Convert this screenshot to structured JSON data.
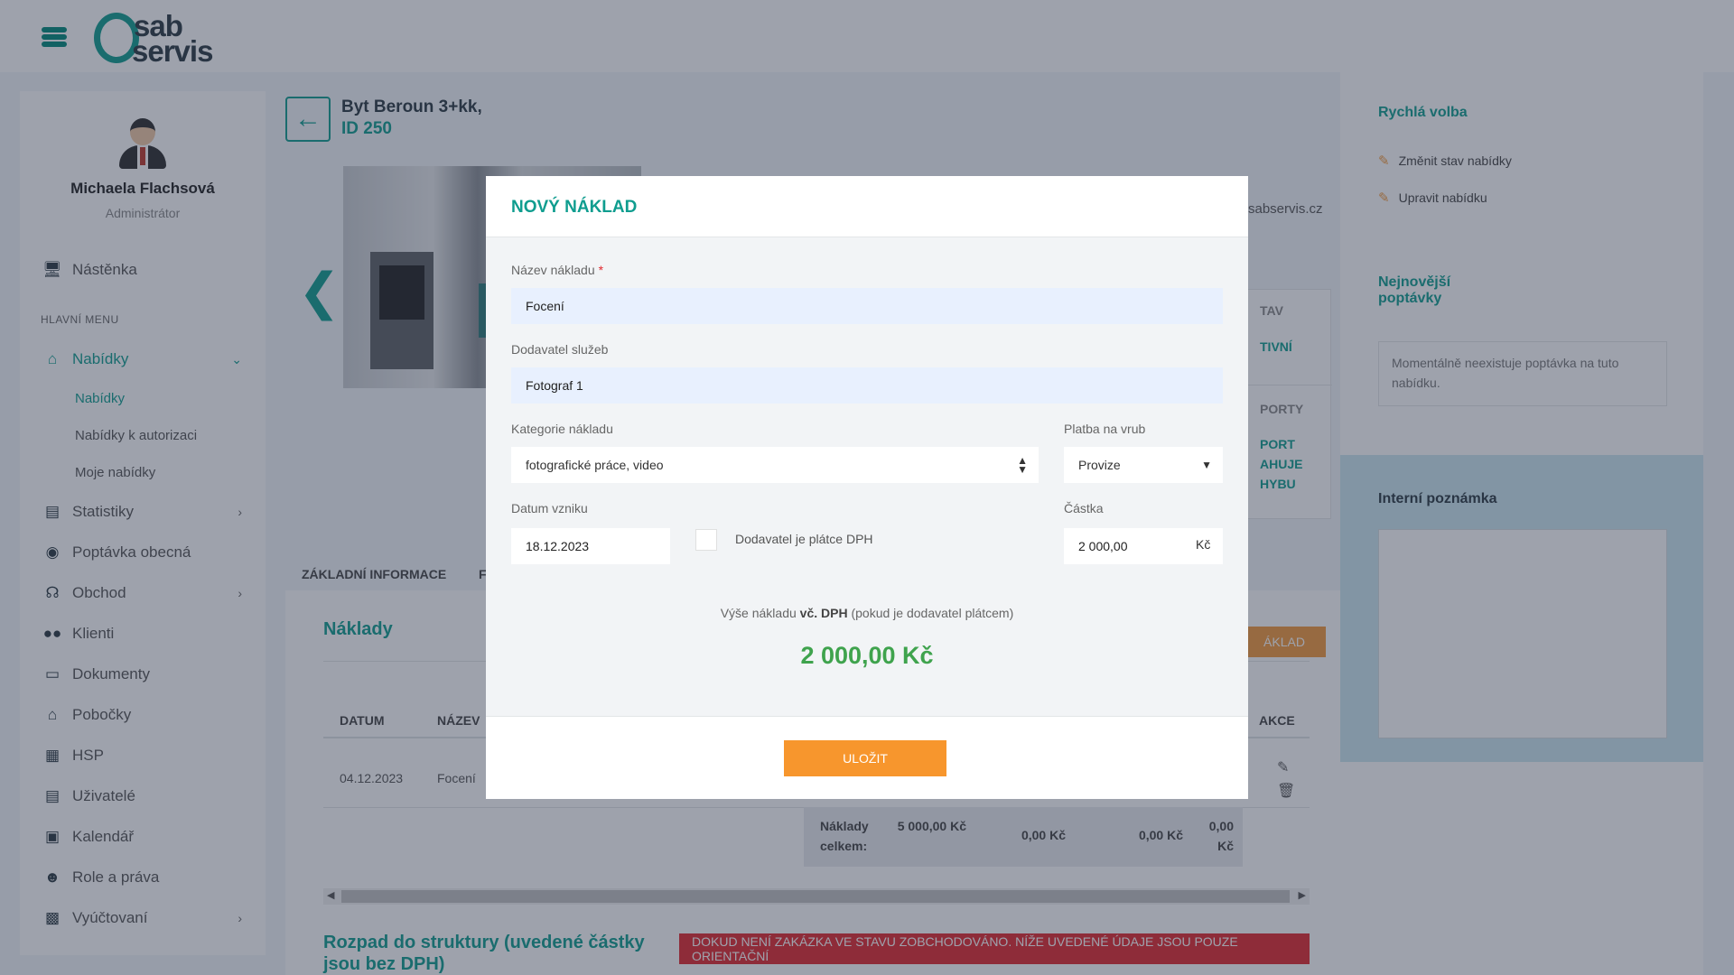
{
  "brand": {
    "logo_top": "sab",
    "logo_bottom": "servis"
  },
  "user": {
    "name": "Michaela Flachsová",
    "role": "Administrátor"
  },
  "sidebar": {
    "dashboard": "Nástěnka",
    "section_label": "HLAVNÍ MENU",
    "items": [
      {
        "label": "Nabídky",
        "icon": "home-icon"
      },
      {
        "label": "Statistiky",
        "icon": "chart-icon"
      },
      {
        "label": "Poptávka obecná",
        "icon": "chat-icon"
      },
      {
        "label": "Obchod",
        "icon": "headset-icon"
      },
      {
        "label": "Klienti",
        "icon": "users-icon"
      },
      {
        "label": "Dokumenty",
        "icon": "archive-icon"
      },
      {
        "label": "Pobočky",
        "icon": "building-icon"
      },
      {
        "label": "HSP",
        "icon": "grid-building-icon"
      },
      {
        "label": "Uživatelé",
        "icon": "id-card-icon"
      },
      {
        "label": "Kalendář",
        "icon": "calendar-icon"
      },
      {
        "label": "Role a práva",
        "icon": "user-gear-icon"
      },
      {
        "label": "Vyúčtovaní",
        "icon": "money-icon"
      }
    ],
    "sub_items": [
      "Nabídky",
      "Nabídky k autorizaci",
      "Moje nabídky"
    ]
  },
  "property": {
    "title": "Byt Beroun 3+kk,",
    "id": "ID 250",
    "email_fragment": "sabservis.cz"
  },
  "status_card": {
    "label1": "TAV",
    "value1": "TIVNÍ",
    "label2": "PORTY",
    "value2": [
      "PORT",
      "AHUJE",
      "HYBU"
    ]
  },
  "tabs": [
    "ZÁKLADNÍ INFORMACE",
    "F"
  ],
  "costs": {
    "title": "Náklady",
    "add_button": "ÁKLAD",
    "headers": {
      "date": "DATUM",
      "name": "NÁZEV",
      "actions": "AKCE"
    },
    "row": {
      "date": "04.12.2023",
      "name": "Focení"
    },
    "summary": {
      "label": "Náklady celkem:",
      "v1": "5 000,00 Kč",
      "v2": "0,00 Kč",
      "v3": "0,00 Kč",
      "v4": "0,00 Kč"
    }
  },
  "structure": {
    "title": "Rozpad do struktury (uvedené částky jsou bez DPH)",
    "warning": "DOKUD NENÍ ZAKÁZKA VE STAVU ZOBCHODOVÁNO. NÍŽE UVEDENÉ ÚDAJE JSOU POUZE ORIENTAČNÍ"
  },
  "right_panel": {
    "quick_title": "Rychlá volba",
    "link1": "Změnit stav nabídky",
    "link2": "Upravit nabídku",
    "newest_title": "Nejnovější poptávky",
    "empty": "Momentálně neexistuje poptávka na tuto nabídku.",
    "note_title": "Interní poznámka"
  },
  "modal": {
    "title": "NOVÝ NÁKLAD",
    "name_label": "Název nákladu",
    "name_required": "*",
    "name_value": "Focení",
    "supplier_label": "Dodavatel služeb",
    "supplier_value": "Fotograf 1",
    "category_label": "Kategorie nákladu",
    "category_value": "fotografické práce, video",
    "payment_label": "Platba na vrub",
    "payment_value": "Provize",
    "date_label": "Datum vzniku",
    "date_value": "18.12.2023",
    "vat_checkbox_label": "Dodavatel je plátce DPH",
    "amount_label": "Částka",
    "amount_value": "2 000,00",
    "amount_unit": "Kč",
    "total_note_pre": "Výše nákladu",
    "total_note_bold": "vč. DPH",
    "total_note_post": "(pokud je dodavatel plátcem)",
    "total_value": "2 000,00 Kč",
    "save_button": "ULOŽIT"
  }
}
